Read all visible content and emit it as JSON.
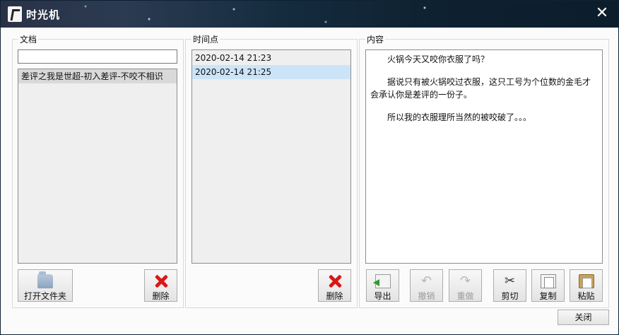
{
  "window": {
    "title": "时光机",
    "close_glyph": "✕"
  },
  "documents": {
    "label": "文档",
    "search_value": "",
    "items": [
      "差评之我是世超-初入差评-不咬不相识"
    ],
    "open_folder_label": "打开文件夹",
    "delete_label": "删除"
  },
  "timepoints": {
    "label": "时间点",
    "items": [
      "2020-02-14 21:23",
      "2020-02-14 21:25"
    ],
    "selected_index": 1,
    "delete_label": "删除"
  },
  "content": {
    "label": "内容",
    "paragraphs": [
      "火锅今天又咬你衣服了吗？",
      "据说只有被火锅咬过衣服，这只工号为个位数的金毛才会承认你是差评的一份子。",
      "所以我的衣服理所当然的被咬破了。。。"
    ],
    "toolbar": {
      "export": "导出",
      "undo": "撤销",
      "redo": "重做",
      "cut": "剪切",
      "copy": "复制",
      "paste": "粘贴"
    }
  },
  "footer": {
    "close_label": "关闭"
  },
  "colors": {
    "selection": "#cce4f7",
    "accent_red": "#d81818"
  }
}
